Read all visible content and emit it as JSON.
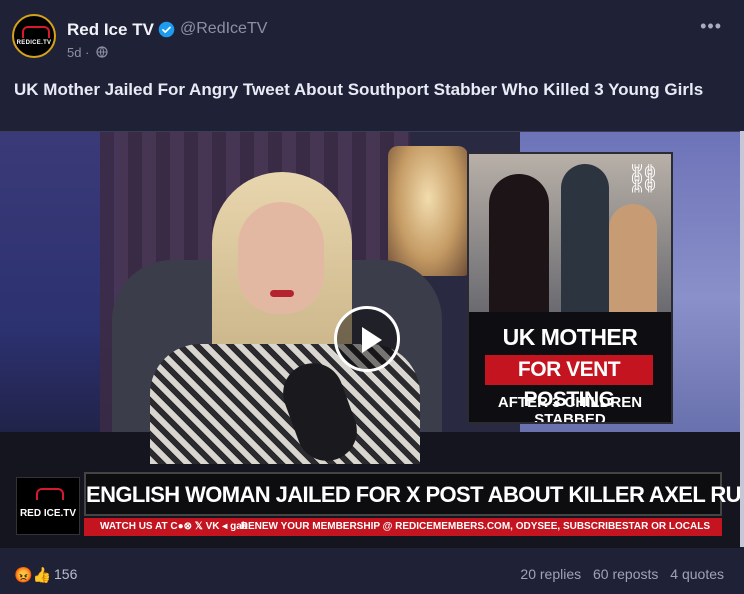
{
  "post": {
    "author_name": "Red Ice TV",
    "handle": "@RedIceTV",
    "age": "5d ·",
    "avatar_text": "REDICE.TV",
    "more_label": "•••",
    "title": "UK Mother Jailed For Angry Tweet About Southport Stabber Who Killed 3 Young Girls"
  },
  "video": {
    "thumb_line1": "UK MOTHER JAILED",
    "thumb_line2": "FOR VENT POSTING",
    "thumb_line3": "AFTER 3 CHILDREN STABBED",
    "lower_third_title": "ENGLISH WOMAN JAILED FOR X POST ABOUT KILLER AXEL RUDAKUBANA",
    "logo_text": "RED ICE.TV",
    "ticker_left": "WATCH US AT C●⊗ 𝕏 VK ◂ gab",
    "ticker_right": "RENEW YOUR MEMBERSHIP @ REDICEMEMBERS.COM, ODYSEE, SUBSCRIBESTAR OR LOCALS"
  },
  "footer": {
    "reaction_icons": "😡👍",
    "reaction_count": "156",
    "replies": "20 replies",
    "reposts": "60 reposts",
    "quotes": "4 quotes"
  },
  "icons": {
    "verified": "verified-icon",
    "globe": "globe-icon",
    "play": "play-icon",
    "handcuffs": "handcuffs-icon"
  },
  "colors": {
    "background": "#1f2236",
    "verified": "#1d9bf0",
    "accent_red": "#c4141f"
  }
}
